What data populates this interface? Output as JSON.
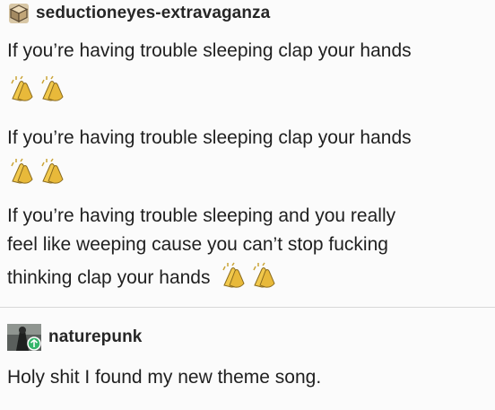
{
  "post1": {
    "username": "seductioneyes-extravaganza",
    "lines": [
      "If you’re having trouble sleeping clap your hands",
      "If you’re having trouble sleeping clap your hands",
      "If you’re having trouble sleeping and you really",
      "feel like weeping cause you can’t stop fucking",
      "thinking clap your hands"
    ],
    "clap_icon": "clapping-hands-emoji"
  },
  "post2": {
    "username": "naturepunk",
    "text": "Holy shit I found my new theme song."
  },
  "colors": {
    "background": "#fbfbfb",
    "text": "#1f1f1f",
    "clap_yellow": "#f2c94c",
    "reblog_green": "#35b66a"
  }
}
